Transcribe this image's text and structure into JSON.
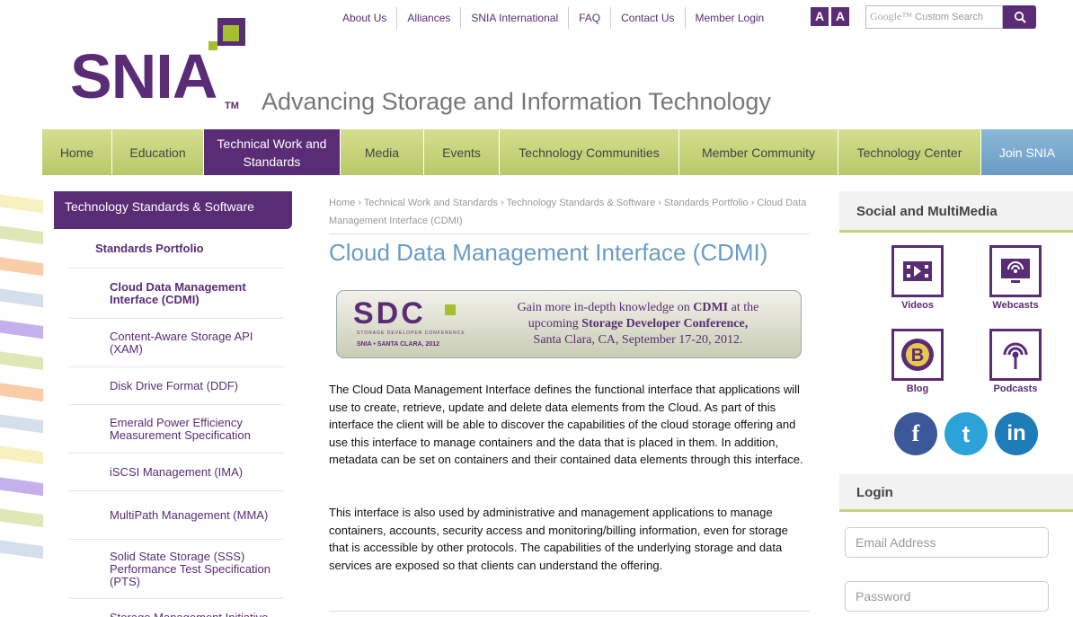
{
  "topnav": [
    "About Us",
    "Alliances",
    "SNIA International",
    "FAQ",
    "Contact Us",
    "Member Login"
  ],
  "fontsize": [
    "A",
    "A"
  ],
  "search": {
    "brand": "Google™",
    "placeholder": "Custom Search"
  },
  "logo": {
    "text": "SNIA",
    "tm": "TM"
  },
  "tagline": "Advancing Storage and Information Technology",
  "mainnav": [
    {
      "label": "Home"
    },
    {
      "label": "Education"
    },
    {
      "label": "Technical Work and Standards"
    },
    {
      "label": "Media"
    },
    {
      "label": "Events"
    },
    {
      "label": "Technology Communities"
    },
    {
      "label": "Member Community"
    },
    {
      "label": "Technology Center"
    },
    {
      "label": "Join SNIA"
    }
  ],
  "sidebar": {
    "header": "Technology Standards & Software",
    "sub": "Standards Portfolio",
    "items": [
      "Cloud Data Management Interface (CDMI)",
      "Content-Aware Storage API (XAM)",
      "Disk Drive Format (DDF)",
      "Emerald Power Efficiency Measurement Specification",
      "iSCSI Management (IMA)",
      "MultiPath Management (MMA)",
      "Solid State Storage (SSS) Performance Test Specification (PTS)",
      "Storage Management Initiative Specification (SMI-S)"
    ]
  },
  "breadcrumb": "Home › Technical Work and Standards › Technology Standards & Software › Standards Portfolio › Cloud Data Management Interface (CDMI)",
  "title": "Cloud Data Management Interface (CDMI)",
  "banner": {
    "brand": "SDC",
    "sub": "STORAGE DEVELOPER CONFERENCE",
    "loc": "SNIA • SANTA CLARA, 2012",
    "line1a": "Gain more in-depth knowledge on ",
    "line1b": "CDMI",
    "line1c": " at the",
    "line2a": "upcoming ",
    "line2b": "Storage Developer Conference,",
    "line3": "Santa Clara, CA, September 17-20, 2012."
  },
  "paragraphs": [
    "The Cloud Data Management Interface defines the functional interface that applications will use to create, retrieve, update and delete data elements from the Cloud. As part of this interface the client will be able to discover the capabilities of the cloud storage offering and use this interface to manage containers and the data that is placed in them. In addition, metadata can be set on containers and their contained data elements through this interface.",
    "This interface is also used by administrative and management applications to manage containers, accounts, security access and monitoring/billing information, even for storage that is accessible by other protocols. The capabilities of the underlying storage and data services are exposed so that clients can understand the offering."
  ],
  "right": {
    "social_title": "Social and MultiMedia",
    "media": [
      "Videos",
      "Webcasts",
      "Blog",
      "Podcasts"
    ],
    "social": [
      {
        "label": "f",
        "color": "#3b5998"
      },
      {
        "label": "t",
        "color": "#2ba3d9"
      },
      {
        "label": "in",
        "color": "#1e7cb8"
      }
    ],
    "login_title": "Login",
    "email_placeholder": "Email Address",
    "password_placeholder": "Password"
  }
}
